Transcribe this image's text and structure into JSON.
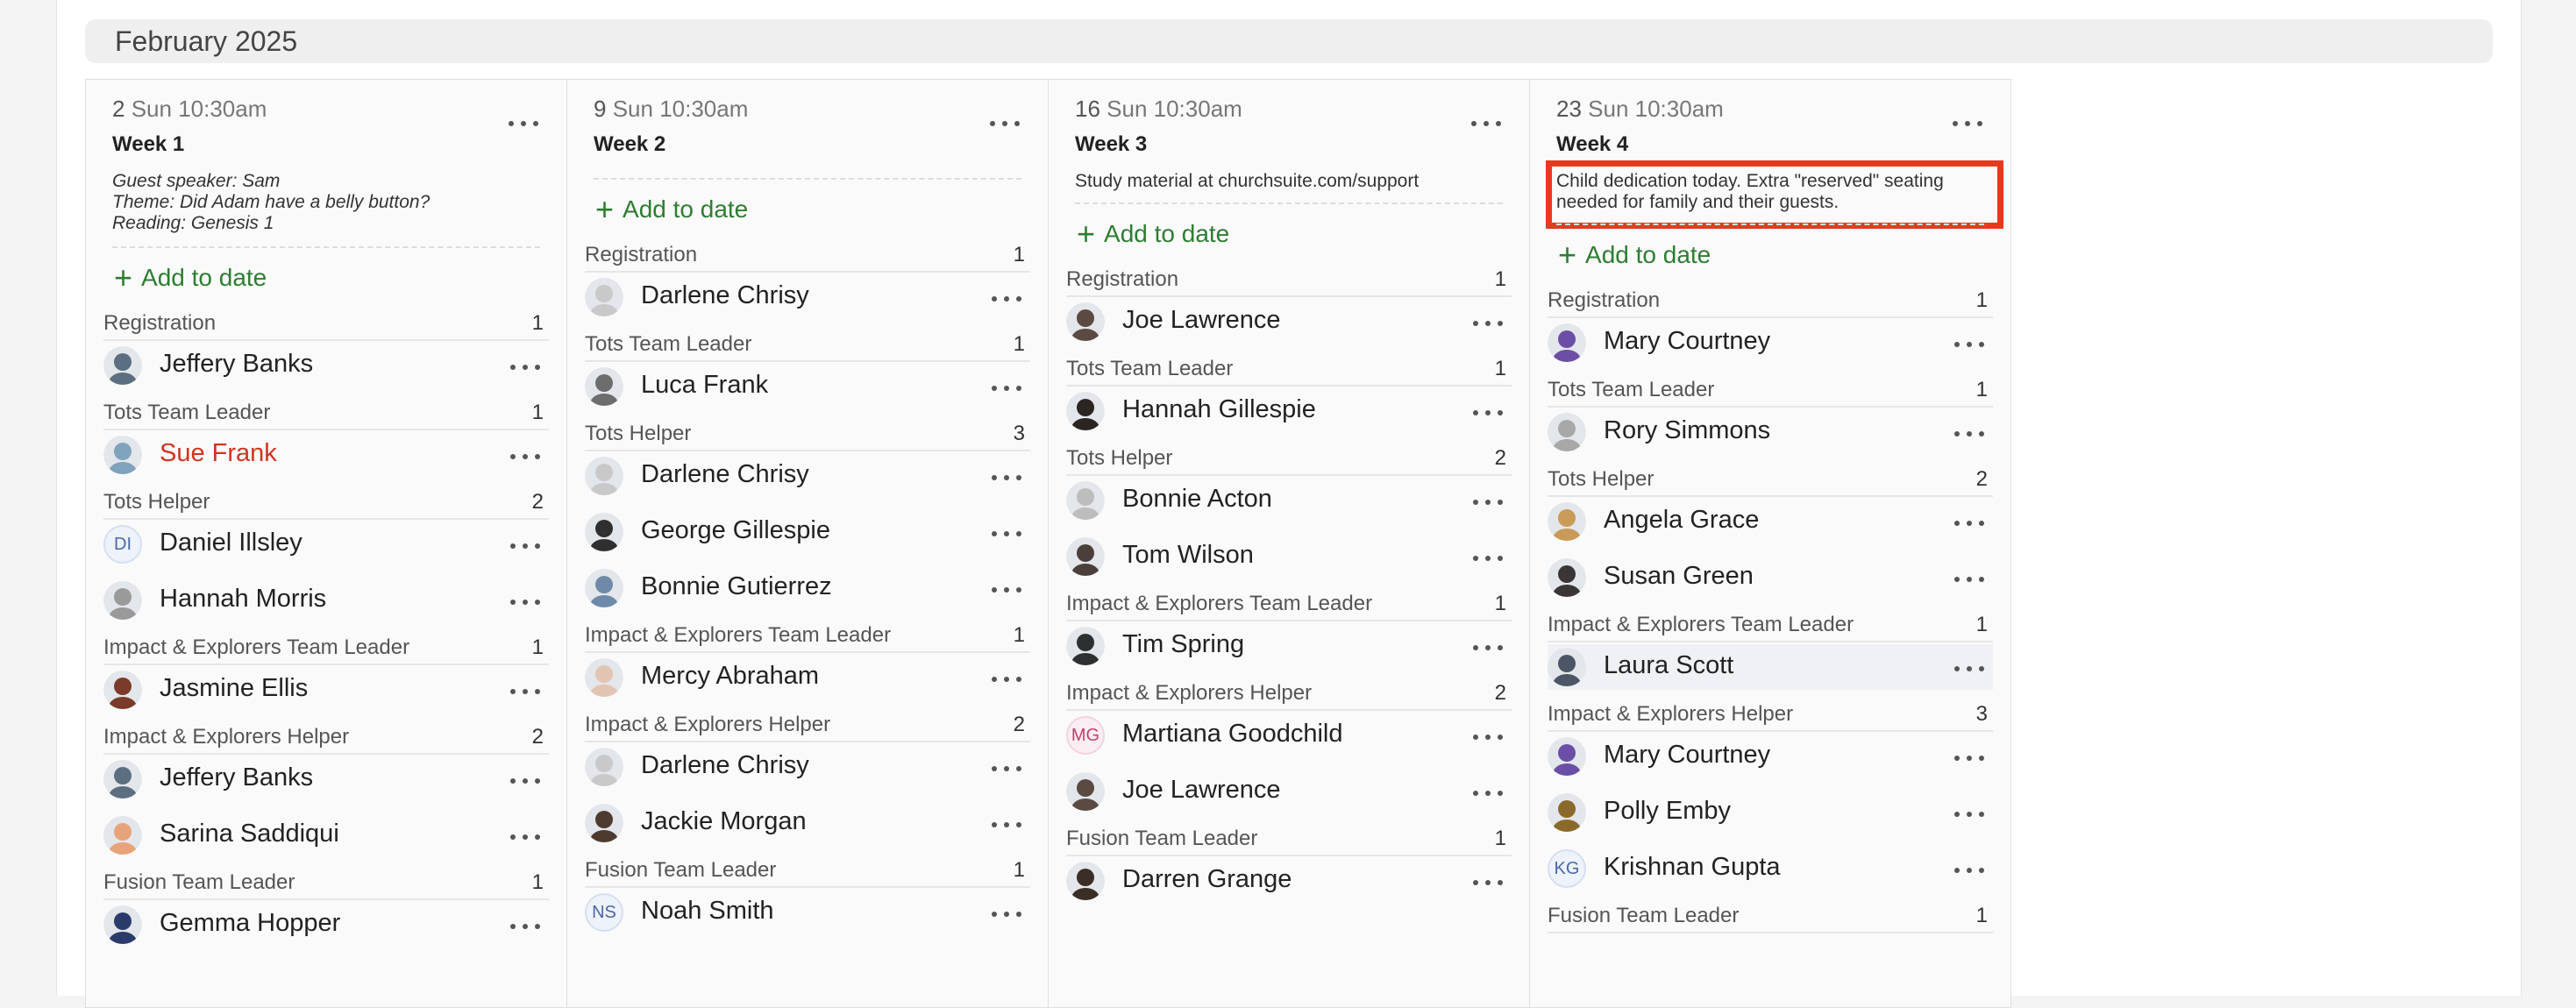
{
  "month": "February 2025",
  "columns": [
    {
      "day": "2",
      "time": "Sun 10:30am",
      "week": "Week 1",
      "notes": [
        "Guest speaker: Sam",
        "Theme: Did Adam have a belly button?",
        "Reading: Genesis 1"
      ],
      "notes_italic": true,
      "add_label": "Add to date",
      "groups": [
        {
          "role": "Registration",
          "count": "1",
          "people": [
            {
              "name": "Jeffery Banks",
              "avatar": "photo",
              "color": "#5b6f80"
            }
          ]
        },
        {
          "role": "Tots Team Leader",
          "count": "1",
          "people": [
            {
              "name": "Sue Frank",
              "avatar": "photo",
              "color": "#7fa3bd",
              "alert": true
            }
          ]
        },
        {
          "role": "Tots Helper",
          "count": "2",
          "people": [
            {
              "name": "Daniel Illsley",
              "avatar": "initials",
              "initials": "DI"
            },
            {
              "name": "Hannah Morris",
              "avatar": "photo",
              "color": "#9a9a9a"
            }
          ]
        },
        {
          "role": "Impact & Explorers Team Leader",
          "count": "1",
          "people": [
            {
              "name": "Jasmine Ellis",
              "avatar": "photo",
              "color": "#7a3b2a"
            }
          ]
        },
        {
          "role": "Impact & Explorers Helper",
          "count": "2",
          "people": [
            {
              "name": "Jeffery Banks",
              "avatar": "photo",
              "color": "#5b6f80"
            },
            {
              "name": "Sarina Saddiqui",
              "avatar": "photo",
              "color": "#e7a37a"
            }
          ]
        },
        {
          "role": "Fusion Team Leader",
          "count": "1",
          "people": [
            {
              "name": "Gemma Hopper",
              "avatar": "photo",
              "color": "#2b3c6b"
            }
          ]
        }
      ]
    },
    {
      "day": "9",
      "time": "Sun 10:30am",
      "week": "Week 2",
      "notes": [],
      "add_label": "Add to date",
      "groups": [
        {
          "role": "Registration",
          "count": "1",
          "people": [
            {
              "name": "Darlene Chrisy",
              "avatar": "photo",
              "color": "#c9c9c9"
            }
          ]
        },
        {
          "role": "Tots Team Leader",
          "count": "1",
          "people": [
            {
              "name": "Luca Frank",
              "avatar": "photo",
              "color": "#6d6d6d"
            }
          ]
        },
        {
          "role": "Tots Helper",
          "count": "3",
          "people": [
            {
              "name": "Darlene Chrisy",
              "avatar": "photo",
              "color": "#c9c9c9"
            },
            {
              "name": "George Gillespie",
              "avatar": "photo",
              "color": "#2f2f2f"
            },
            {
              "name": "Bonnie Gutierrez",
              "avatar": "photo",
              "color": "#6e8aa8"
            }
          ]
        },
        {
          "role": "Impact & Explorers Team Leader",
          "count": "1",
          "people": [
            {
              "name": "Mercy Abraham",
              "avatar": "photo",
              "color": "#e2c4b2"
            }
          ]
        },
        {
          "role": "Impact & Explorers Helper",
          "count": "2",
          "people": [
            {
              "name": "Darlene Chrisy",
              "avatar": "photo",
              "color": "#c9c9c9"
            },
            {
              "name": "Jackie Morgan",
              "avatar": "photo",
              "color": "#4d3b30"
            }
          ]
        },
        {
          "role": "Fusion Team Leader",
          "count": "1",
          "people": [
            {
              "name": "Noah Smith",
              "avatar": "initials",
              "initials": "NS"
            }
          ]
        }
      ]
    },
    {
      "day": "16",
      "time": "Sun 10:30am",
      "week": "Week 3",
      "notes": [
        "Study material at churchsuite.com/support"
      ],
      "add_label": "Add to date",
      "groups": [
        {
          "role": "Registration",
          "count": "1",
          "people": [
            {
              "name": "Joe Lawrence",
              "avatar": "photo",
              "color": "#5a4a42"
            }
          ]
        },
        {
          "role": "Tots Team Leader",
          "count": "1",
          "people": [
            {
              "name": "Hannah Gillespie",
              "avatar": "photo",
              "color": "#2b2522"
            }
          ]
        },
        {
          "role": "Tots Helper",
          "count": "2",
          "people": [
            {
              "name": "Bonnie Acton",
              "avatar": "photo",
              "color": "#bdbdbd"
            },
            {
              "name": "Tom Wilson",
              "avatar": "photo",
              "color": "#4a3f3a"
            }
          ]
        },
        {
          "role": "Impact & Explorers Team Leader",
          "count": "1",
          "people": [
            {
              "name": "Tim Spring",
              "avatar": "photo",
              "color": "#2c3030"
            }
          ]
        },
        {
          "role": "Impact & Explorers Helper",
          "count": "2",
          "people": [
            {
              "name": "Martiana Goodchild",
              "avatar": "initials",
              "initials": "MG",
              "pink": true
            },
            {
              "name": "Joe Lawrence",
              "avatar": "photo",
              "color": "#5a4a42"
            }
          ]
        },
        {
          "role": "Fusion Team Leader",
          "count": "1",
          "people": [
            {
              "name": "Darren Grange",
              "avatar": "photo",
              "color": "#3b2e27"
            }
          ]
        }
      ]
    },
    {
      "day": "23",
      "time": "Sun 10:30am",
      "week": "Week 4",
      "notes": [
        "Child dedication today. Extra \"reserved\" seating",
        "needed for family and their guests."
      ],
      "add_label": "Add to date",
      "groups": [
        {
          "role": "Registration",
          "count": "1",
          "people": [
            {
              "name": "Mary Courtney",
              "avatar": "photo",
              "color": "#6b4fa6"
            }
          ]
        },
        {
          "role": "Tots Team Leader",
          "count": "1",
          "people": [
            {
              "name": "Rory Simmons",
              "avatar": "photo",
              "color": "#a8a8a8"
            }
          ]
        },
        {
          "role": "Tots Helper",
          "count": "2",
          "people": [
            {
              "name": "Angela Grace",
              "avatar": "photo",
              "color": "#c99a58"
            },
            {
              "name": "Susan Green",
              "avatar": "photo",
              "color": "#3b3636"
            }
          ]
        },
        {
          "role": "Impact & Explorers Team Leader",
          "count": "1",
          "people": [
            {
              "name": "Laura Scott",
              "avatar": "photo",
              "color": "#4d5666",
              "hover": true
            }
          ]
        },
        {
          "role": "Impact & Explorers Helper",
          "count": "3",
          "people": [
            {
              "name": "Mary Courtney",
              "avatar": "photo",
              "color": "#6b4fa6"
            },
            {
              "name": "Polly Emby",
              "avatar": "photo",
              "color": "#8a6a2c"
            },
            {
              "name": "Krishnan Gupta",
              "avatar": "initials",
              "initials": "KG"
            }
          ]
        },
        {
          "role": "Fusion Team Leader",
          "count": "1",
          "people": []
        }
      ]
    }
  ]
}
